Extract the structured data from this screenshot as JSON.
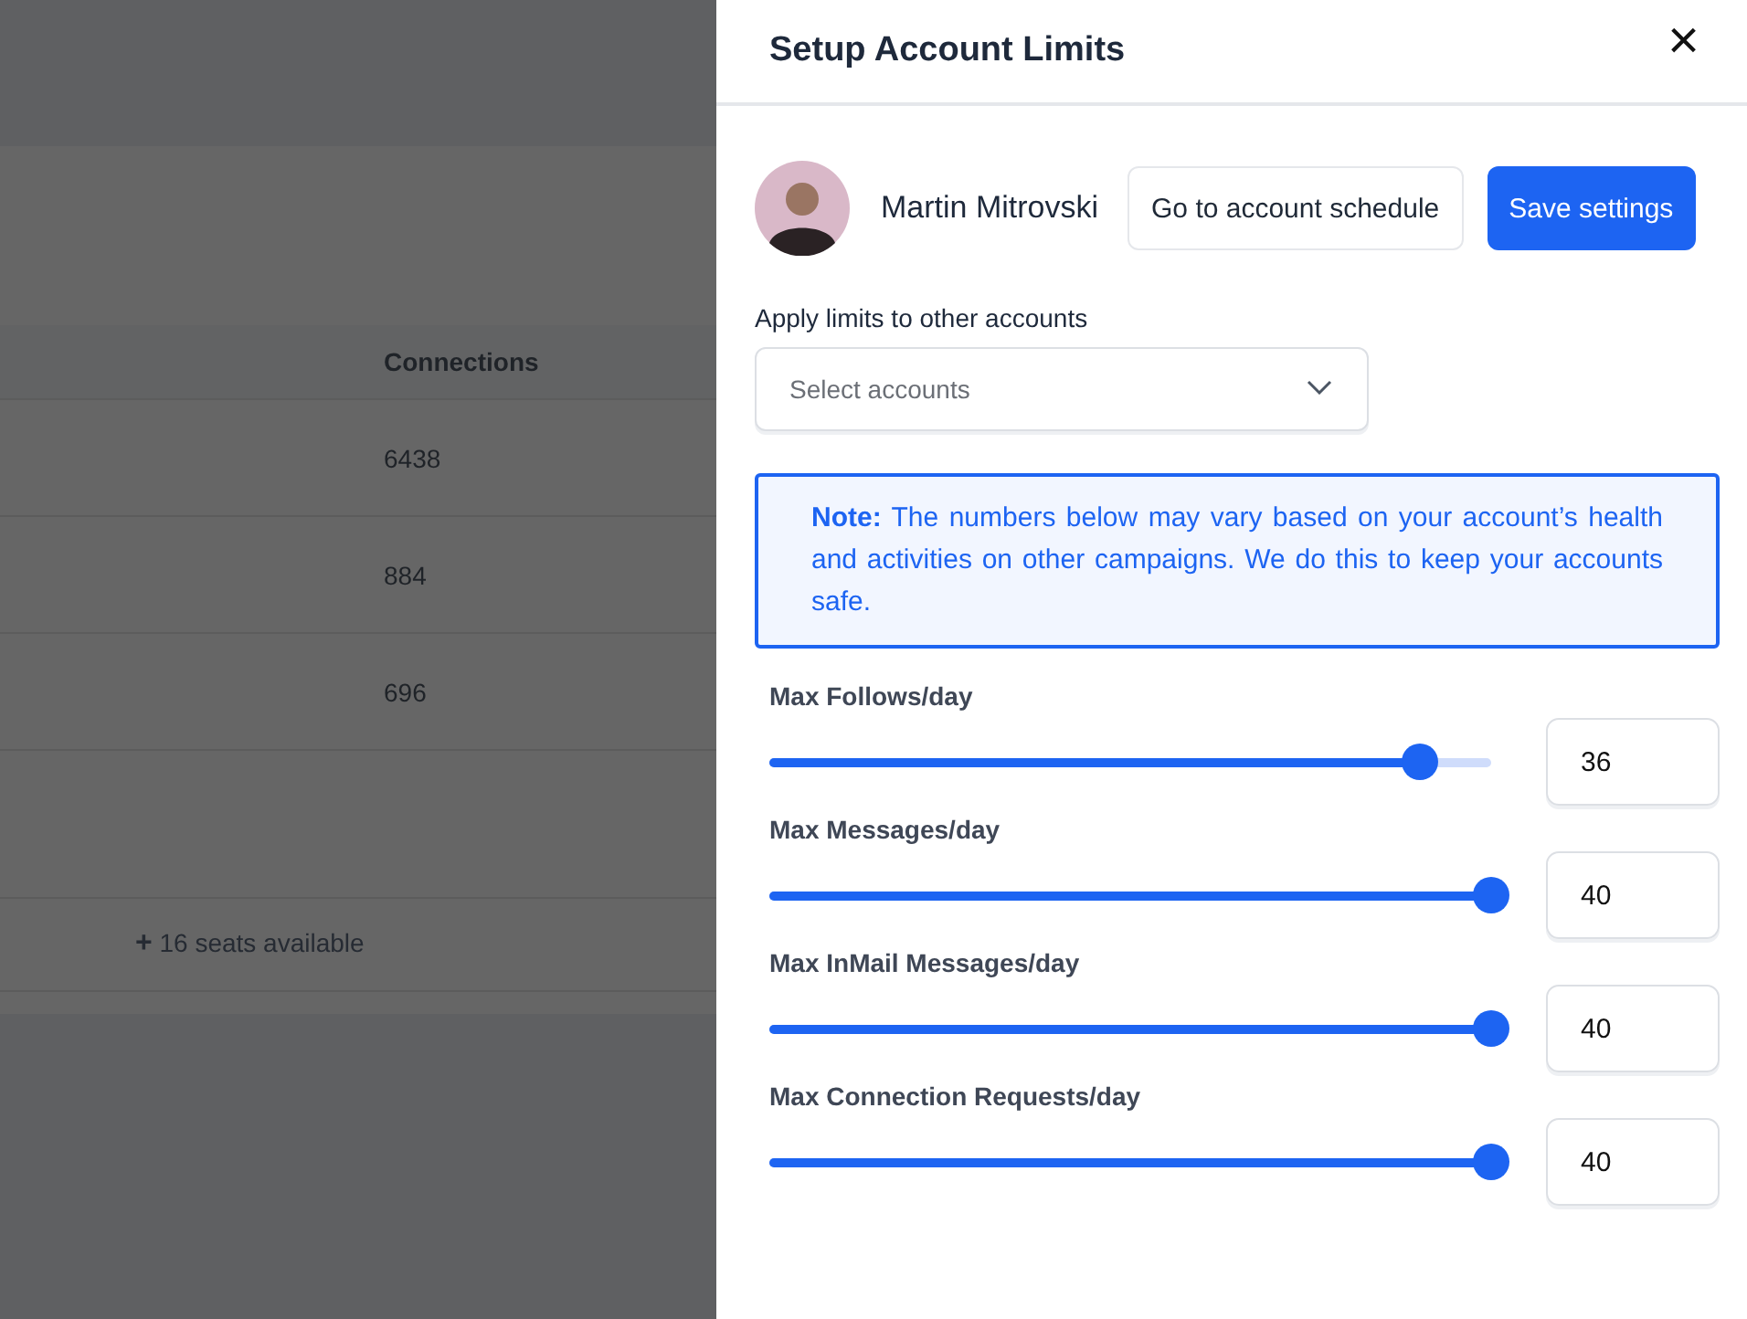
{
  "table": {
    "columns": [
      "Connections"
    ],
    "rows": [
      {
        "connections": "6438"
      },
      {
        "connections": "884"
      },
      {
        "connections": "696"
      }
    ],
    "seats_link": {
      "icon": "+",
      "label": "16 seats available"
    }
  },
  "drawer": {
    "title": "Setup Account Limits",
    "close": "×",
    "account": {
      "name": "Martin Mitrovski"
    },
    "buttons": [
      {
        "label": "Go to account schedule",
        "kind": "secondary"
      },
      {
        "label": "Save settings",
        "kind": "primary"
      }
    ],
    "apply": {
      "label": "Apply limits to other accounts",
      "placeholder": "Select accounts"
    },
    "note": "**Note:** The numbers below may vary based on your account’s health and activities on other campaigns. We do this to keep your accounts safe.",
    "limits": [
      {
        "label": "Max Follows/day",
        "level": 0.9,
        "value": "36"
      },
      {
        "label": "Max Messages/day",
        "level": 1,
        "value": "40"
      },
      {
        "label": "Max InMail Messages/day",
        "level": 1,
        "value": "40"
      },
      {
        "label": "Max Connection Requests/day",
        "level": 1,
        "value": "40"
      }
    ]
  }
}
